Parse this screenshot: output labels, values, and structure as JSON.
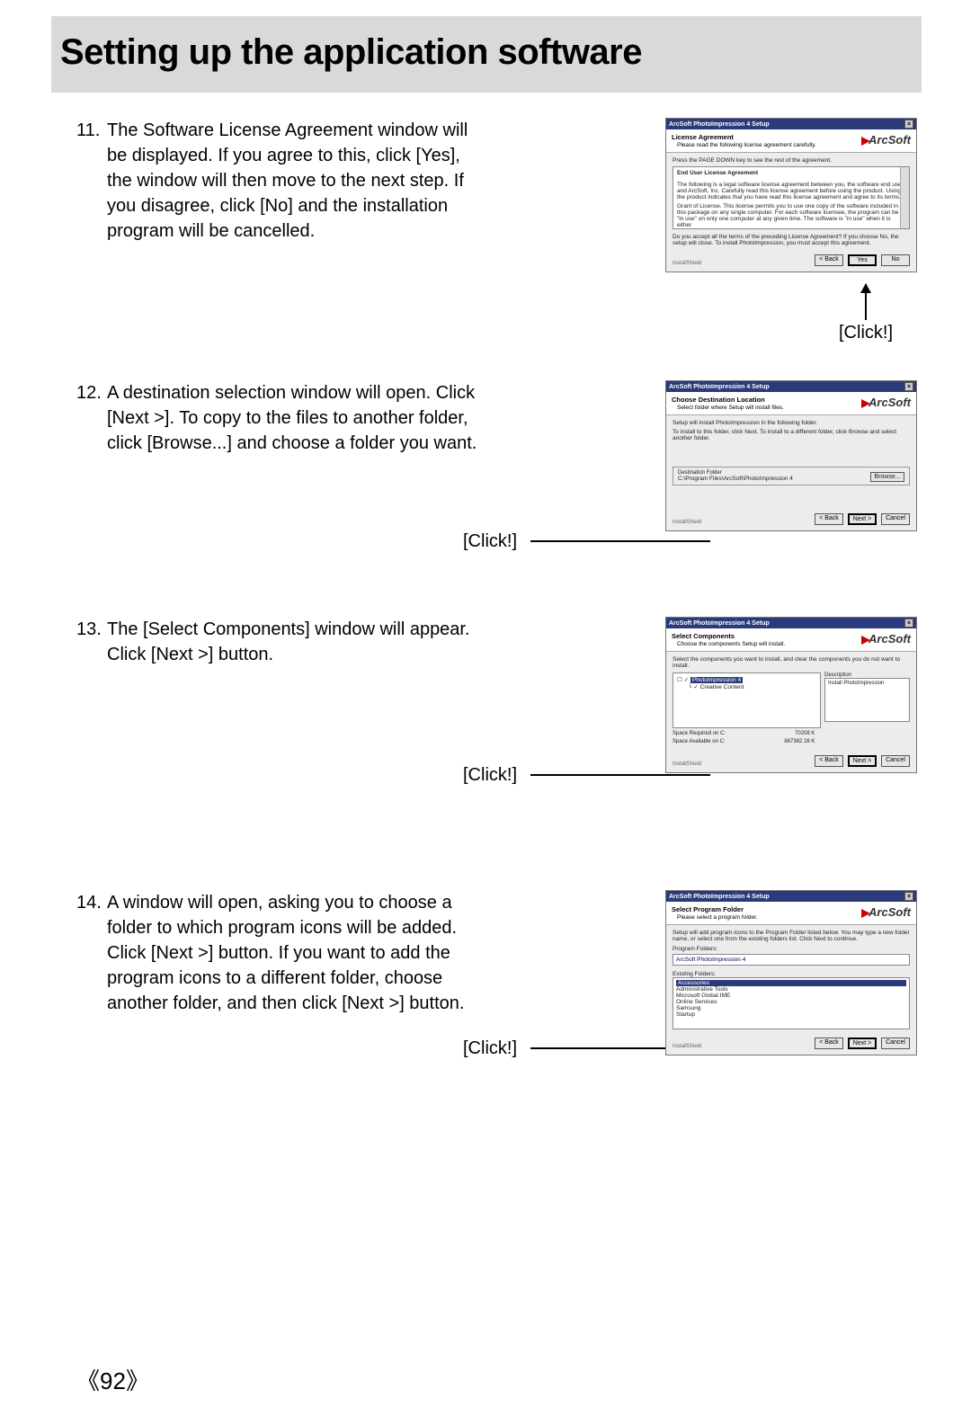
{
  "page_title": "Setting up the application software",
  "page_number": "92",
  "click_label": "[Click!]",
  "brand_name": "ArcSoft",
  "steps": [
    {
      "num": "11.",
      "text": "The Software License Agreement window will be displayed. If you agree to this, click [Yes], the window will then move to the next step. If you disagree, click [No] and the installation program will be cancelled."
    },
    {
      "num": "12.",
      "text": "A destination selection window will open. Click [Next >]. To copy to the files to another folder, click [Browse...] and choose a folder you want."
    },
    {
      "num": "13.",
      "text": "The [Select Components] window will appear. Click [Next >] button."
    },
    {
      "num": "14.",
      "text": "A window will open, asking you to choose a folder to which program icons will be added. Click [Next >] button. If you want to add the program icons to a different folder, choose another folder, and then click [Next >] button."
    }
  ],
  "dlg_title": "ArcSoft PhotoImpression 4 Setup",
  "install_shield": "InstallShield",
  "buttons": {
    "back": "< Back",
    "yes": "Yes",
    "no": "No",
    "next": "Next >",
    "cancel": "Cancel",
    "browse": "Browse..."
  },
  "dlg11": {
    "header_h1": "License Agreement",
    "header_h2": "Please read the following license agreement carefully.",
    "instruction": "Press the PAGE DOWN key to see the rest of the agreement.",
    "eula_head": "End User License Agreement",
    "eula_p1": "The following is a legal software license agreement between you, the software end user, and ArcSoft, Inc. Carefully read this license agreement before using the product. Using the product indicates that you have read this license agreement and agree to its terms.",
    "eula_p2": "Grant of License. This license permits you to use one copy of the software included in this package on any single computer. For each software licensee, the program can be \"in use\" on only one computer at any given time. The software is \"in use\" when it is either",
    "accept_text": "Do you accept all the terms of the preceding License Agreement? If you choose No, the setup will close. To install PhotoImpression, you must accept this agreement."
  },
  "dlg12": {
    "header_h1": "Choose Destination Location",
    "header_h2": "Select folder where Setup will install files.",
    "line1": "Setup will install PhotoImpression in the following folder.",
    "line2": "To install to this folder, click Next. To install to a different folder, click Browse and select another folder.",
    "dest_label": "Destination Folder",
    "dest_path": "C:\\Program Files\\ArcSoft\\PhotoImpression 4"
  },
  "dlg13": {
    "header_h1": "Select Components",
    "header_h2": "Choose the components Setup will install.",
    "instruction": "Select the components you want to install, and clear the components you do not want to install.",
    "tree_item1": "PhotoImpression 4",
    "tree_item2": "Creative Content",
    "desc_label": "Description",
    "desc_text": "Install PhotoImpression",
    "space_req_label": "Space Required on  C:",
    "space_req_val": "70208 K",
    "space_avail_label": "Space Available on  C:",
    "space_avail_val": "887362  28 K"
  },
  "dlg14": {
    "header_h1": "Select Program Folder",
    "header_h2": "Please select a program folder.",
    "instruction": "Setup will add program icons to the Program Folder listed below. You may type a new folder name, or select one from the existing folders list. Click Next to continue.",
    "program_folders": "Program Folders:",
    "program_value": "ArcSoft PhotoImpression 4",
    "existing_label": "Existing Folders:",
    "existing": [
      "Accessories",
      "Administrative Tools",
      "Microsoft Global IME",
      "Online Services",
      "Samsung",
      "Startup"
    ]
  }
}
